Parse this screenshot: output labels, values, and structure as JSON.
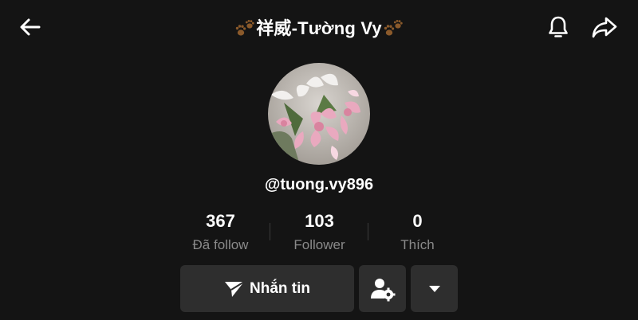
{
  "header": {
    "title": "祥威-Tường Vy",
    "title_emoji": "paw-prints-icon"
  },
  "profile": {
    "username": "@tuong.vy896",
    "avatar": "pink-lily-flowers-photo"
  },
  "stats": [
    {
      "value": "367",
      "label": "Đã follow"
    },
    {
      "value": "103",
      "label": "Follower"
    },
    {
      "value": "0",
      "label": "Thích"
    }
  ],
  "actions": {
    "message_label": "Nhắn tin"
  },
  "icons": {
    "back": "arrow-left-icon",
    "bell": "bell-icon",
    "share": "share-arrow-icon",
    "send": "send-icon",
    "person_settings": "person-settings-icon",
    "more": "caret-down-icon"
  },
  "colors": {
    "background": "#141414",
    "button": "#2e2e2e",
    "text": "#ffffff",
    "muted": "#8a8a8a",
    "paw": "#8b5a2b"
  }
}
